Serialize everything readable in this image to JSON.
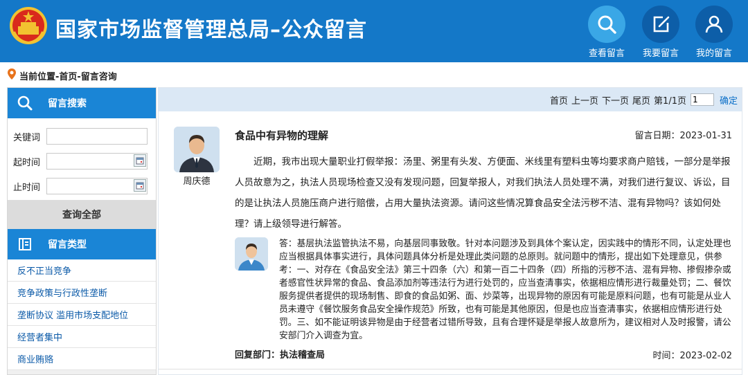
{
  "header": {
    "title": "国家市场监督管理总局–公众留言",
    "emblem_icon": "national-emblem-icon",
    "nav": [
      {
        "label": "查看留言",
        "icon": "search-icon"
      },
      {
        "label": "我要留言",
        "icon": "edit-icon"
      },
      {
        "label": "我的留言",
        "icon": "user-icon"
      }
    ]
  },
  "breadcrumb": "当前位置-首页-留言咨询",
  "sidebar": {
    "search_title": "留言搜索",
    "keyword_label": "关键词",
    "keyword_value": "",
    "start_label": "起时间",
    "start_value": "",
    "end_label": "止时间",
    "end_value": "",
    "query_all": "查询全部",
    "type_title": "留言类型",
    "categories": [
      "反不正当竞争",
      "竞争政策与行政性垄断",
      "垄断协议 滥用市场支配地位",
      "经营者集中",
      "商业贿赂"
    ]
  },
  "pager": {
    "first": "首页",
    "prev": "上一页",
    "next": "下一页",
    "last": "尾页",
    "page_info": "第1/1页",
    "page_input": "1",
    "confirm": "确定"
  },
  "message": {
    "author": "周庆德",
    "title": "食品中有异物的理解",
    "date": "留言日期：2023-01-31",
    "body": "近期，我市出现大量职业打假举报：汤里、粥里有头发、方便面、米线里有塑料虫等均要求商户赔钱，一部分是举报人员故意为之，执法人员现场检查又没有发现问题，回复举报人，对我们执法人员处理不满，对我们进行复议、诉讼，目的是让执法人员施压商户进行赔偿，占用大量执法资源。请问这些情况算食品安全法污秽不洁、混有异物吗？该如何处理？请上级领导进行解答。"
  },
  "reply": {
    "body": "答：基层执法监管执法不易，向基层同事致敬。针对本问题涉及到具体个案认定，因实践中的情形不同，认定处理也应当根据具体事实进行，具体问题具体分析是处理此类问题的总原则。就问题中的情形，提出如下处理意见，供参考：一、对存在《食品安全法》第三十四条（六）和第一百二十四条（四）所指的污秽不洁、混有异物、掺假掺杂或者感官性状异常的食品、食品添加剂等违法行为进行处罚的，应当查清事实，依据相应情形进行裁量处罚；二、餐饮服务提供者提供的现场制售、即食的食品如粥、面、炒菜等，出现异物的原因有可能是原料问题，也有可能是从业人员未遵守《餐饮服务食品安全操作规范》所致，也有可能是其他原因，但是也应当查清事实，依据相应情形进行处罚。三、如不能证明该异物是由于经营者过错所导致，且有合理怀疑是举报人故意所为，建议相对人及时报警，请公安部门介入调查为宜。",
    "dept": "回复部门：执法稽查局",
    "time": "时间：2023-02-02"
  },
  "colors": {
    "header_bg": "#1478c8",
    "sidebar_head": "#1a85d6",
    "link": "#0b5aa8",
    "pager_bg": "#dbe8f5"
  }
}
